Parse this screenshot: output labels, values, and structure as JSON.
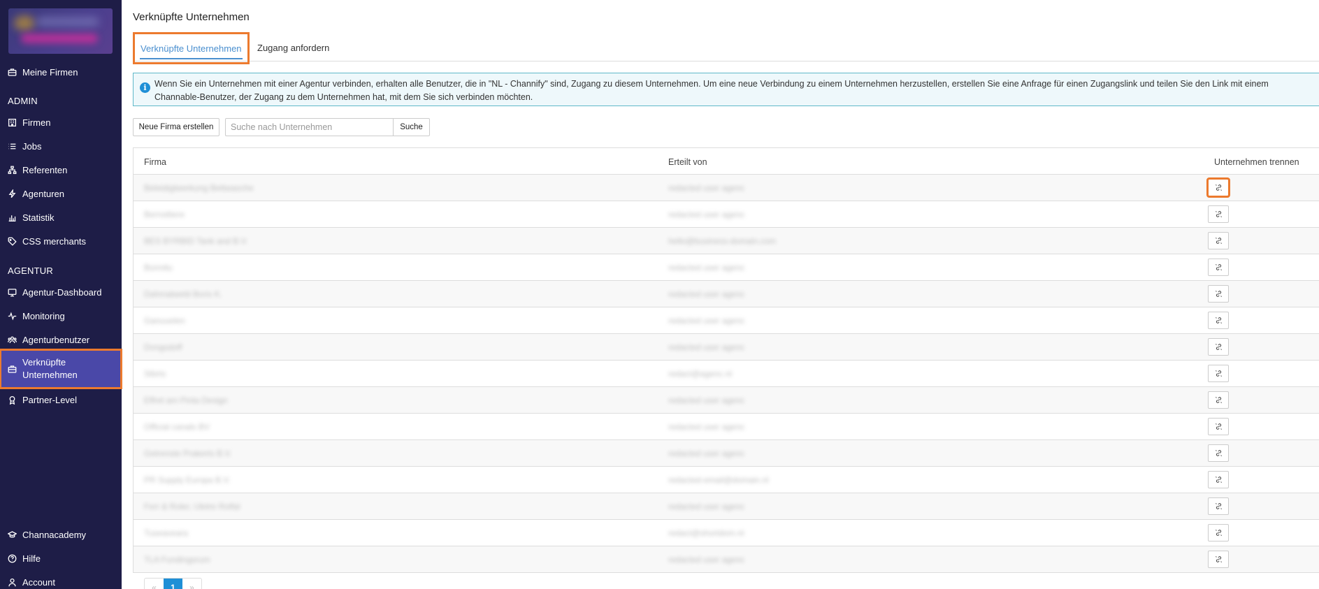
{
  "sidebar": {
    "items": [
      {
        "label": "Meine Firmen",
        "icon": "briefcase-icon"
      },
      {
        "label": "Firmen",
        "icon": "building-icon"
      },
      {
        "label": "Jobs",
        "icon": "list-icon"
      },
      {
        "label": "Referenten",
        "icon": "sitemap-icon"
      },
      {
        "label": "Agenturen",
        "icon": "bolt-icon"
      },
      {
        "label": "Statistik",
        "icon": "bar-chart-icon"
      },
      {
        "label": "CSS merchants",
        "icon": "tag-icon"
      },
      {
        "label": "Agentur-Dashboard",
        "icon": "monitor-icon"
      },
      {
        "label": "Monitoring",
        "icon": "activity-icon"
      },
      {
        "label": "Agenturbenutzer",
        "icon": "users-icon"
      },
      {
        "label": "Verknüpfte Unternehmen",
        "icon": "briefcase-icon"
      },
      {
        "label": "Partner-Level",
        "icon": "award-icon"
      },
      {
        "label": "Channacademy",
        "icon": "graduation-cap-icon"
      },
      {
        "label": "Hilfe",
        "icon": "help-circle-icon"
      },
      {
        "label": "Account",
        "icon": "user-icon"
      }
    ],
    "sections": {
      "admin": "ADMIN",
      "agentur": "AGENTUR"
    }
  },
  "page": {
    "title": "Verknüpfte Unternehmen"
  },
  "tabs": [
    {
      "label": "Verknüpfte Unternehmen",
      "active": true
    },
    {
      "label": "Zugang anfordern",
      "active": false
    }
  ],
  "info": {
    "line1": "Wenn Sie ein Unternehmen mit einer Agentur verbinden, erhalten alle Benutzer, die in \"NL - Channify\" sind, Zugang zu diesem Unternehmen. Um eine neue Verbindung zu einem Unternehmen herzustellen, erstellen Sie eine Anfrage für einen Zugangslink und teilen Sie den Link mit einem",
    "line2": "Channable-Benutzer, der Zugang zu dem Unternehmen hat, mit dem Sie sich verbinden möchten."
  },
  "toolbar": {
    "new_company_label": "Neue Firma erstellen",
    "search_placeholder": "Suche nach Unternehmen",
    "search_button_label": "Suche"
  },
  "table": {
    "headers": {
      "company": "Firma",
      "granted_by": "Erteilt von",
      "disconnect": "Unternehmen trennen"
    },
    "rows": [
      {
        "company": "Beleidigtwerkung Bettwasche",
        "granted_by": "redacted user agenc"
      },
      {
        "company": "Bernsttiere",
        "granted_by": "redacted user agenc"
      },
      {
        "company": "BES BYRBID Tank and B.V.",
        "granted_by": "hello@business-domain.com"
      },
      {
        "company": "Bonnitu",
        "granted_by": "redacted user agenc"
      },
      {
        "company": "Dahmatweld Boris K.",
        "granted_by": "redacted user agenc"
      },
      {
        "company": "Ganuuelen",
        "granted_by": "redacted user agenc"
      },
      {
        "company": "Dongsdoff",
        "granted_by": "redacted user agenc"
      },
      {
        "company": "Stbrts",
        "granted_by": "redact@agenc.nl"
      },
      {
        "company": "Effret am Pinta Design",
        "granted_by": "redacted user agenc"
      },
      {
        "company": "Official canals BV",
        "granted_by": "redacted user agenc"
      },
      {
        "company": "Getrenste Prakerts B.V.",
        "granted_by": "redacted user agenc"
      },
      {
        "company": "PR Supply Europa B.V.",
        "granted_by": "redacted-email@domain.nl"
      },
      {
        "company": "Ferr & Roler, Uletre Rolfal",
        "granted_by": "redacted user agenc"
      },
      {
        "company": "Tuseaveara",
        "granted_by": "redact@shortdom.nl"
      },
      {
        "company": "TLA Fundingsrum",
        "granted_by": "redacted user agenc"
      }
    ]
  },
  "pagination": {
    "prev": "«",
    "current": "1",
    "next": "»"
  }
}
